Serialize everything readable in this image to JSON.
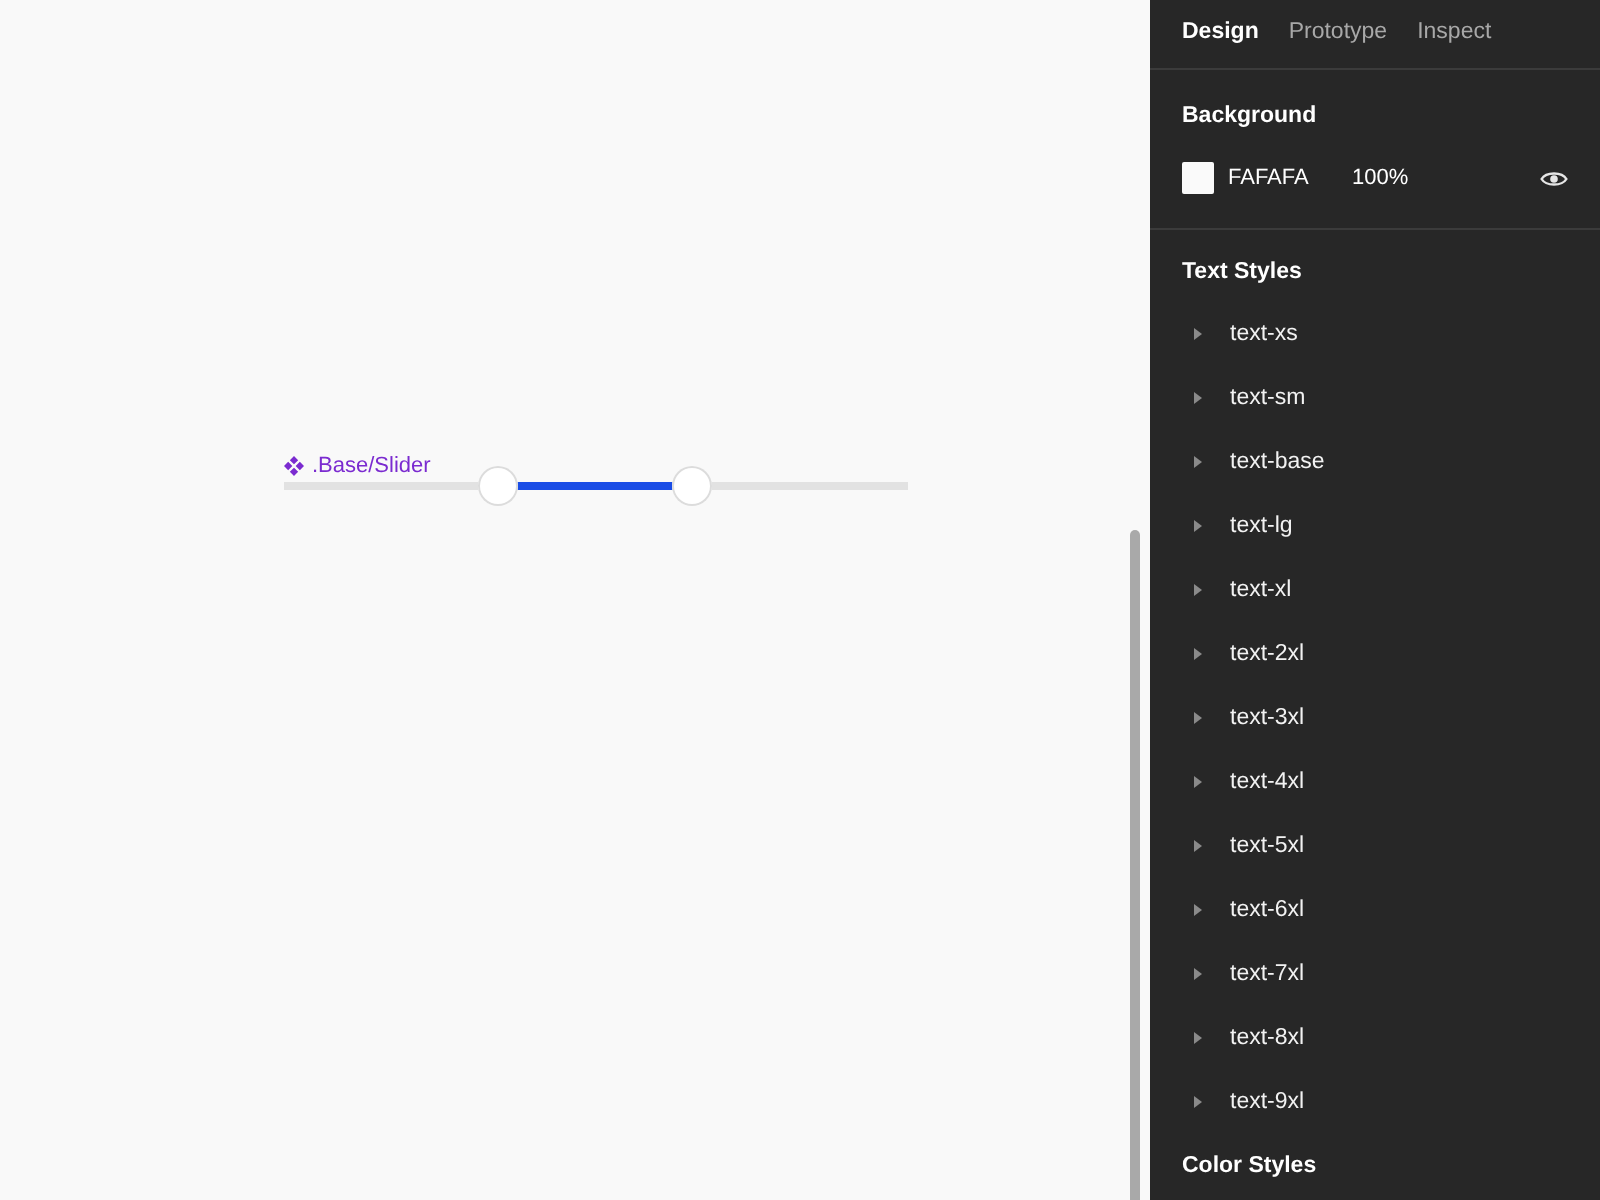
{
  "canvas": {
    "component": {
      "name": ".Base/Slider",
      "slider": {
        "thumbs": [
          {
            "level": 0.343
          },
          {
            "level": 0.654
          }
        ]
      }
    }
  },
  "tabs": [
    {
      "label": "Design",
      "selected": true
    },
    {
      "label": "Prototype",
      "selected": false
    },
    {
      "label": "Inspect",
      "selected": false
    }
  ],
  "background": {
    "title": "Background",
    "hex": "FAFAFA",
    "opacity": "100%"
  },
  "text_styles": {
    "title": "Text Styles",
    "items": [
      {
        "name": "text-xs",
        "expanded": false
      },
      {
        "name": "text-sm",
        "expanded": false
      },
      {
        "name": "text-base",
        "expanded": false
      },
      {
        "name": "text-lg",
        "expanded": false
      },
      {
        "name": "text-xl",
        "expanded": false
      },
      {
        "name": "text-2xl",
        "expanded": false
      },
      {
        "name": "text-3xl",
        "expanded": false
      },
      {
        "name": "text-4xl",
        "expanded": false
      },
      {
        "name": "text-5xl",
        "expanded": false
      },
      {
        "name": "text-6xl",
        "expanded": false
      },
      {
        "name": "text-7xl",
        "expanded": false
      },
      {
        "name": "text-8xl",
        "expanded": false
      },
      {
        "name": "text-9xl",
        "expanded": false
      }
    ]
  },
  "color_styles": {
    "title": "Color Styles"
  }
}
